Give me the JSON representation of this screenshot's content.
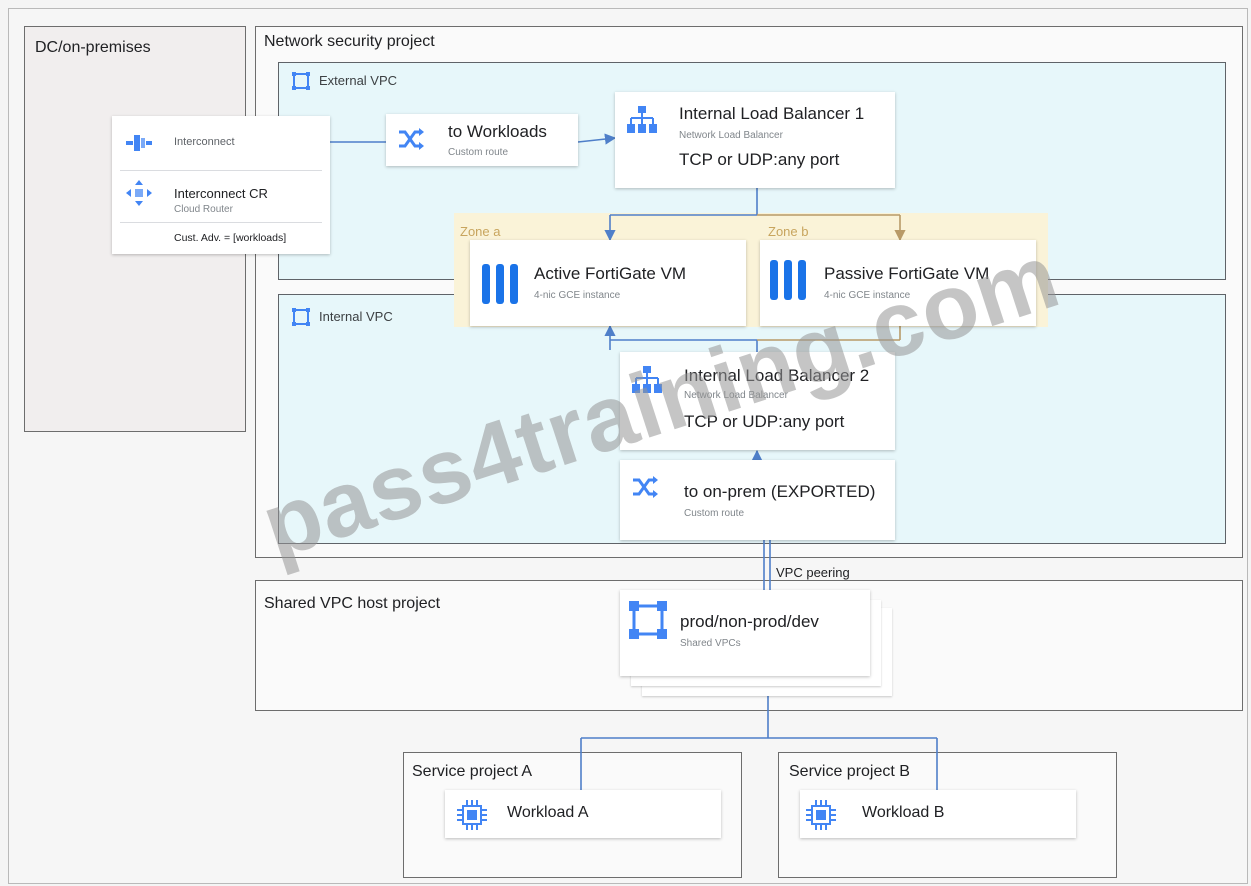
{
  "dc": {
    "title": "DC/on-premises"
  },
  "network_security_project": {
    "title": "Network security project",
    "external_vpc": {
      "label": "External VPC"
    },
    "internal_vpc": {
      "label": "Internal VPC"
    },
    "zone_a": "Zone a",
    "zone_b": "Zone b"
  },
  "interconnect_card": {
    "interconnect_label": "Interconnect",
    "router_title": "Interconnect CR",
    "router_sub": "Cloud Router",
    "advert": "Cust. Adv. = [workloads]"
  },
  "route_to_workloads": {
    "title": "to Workloads",
    "sub": "Custom route"
  },
  "ilb1": {
    "title": "Internal Load Balancer 1",
    "sub": "Network Load Balancer",
    "ports": "TCP or UDP:any port"
  },
  "active_vm": {
    "title": "Active FortiGate VM",
    "sub": "4-nic GCE instance"
  },
  "passive_vm": {
    "title": "Passive FortiGate VM",
    "sub": "4-nic GCE instance"
  },
  "ilb2": {
    "title": "Internal Load Balancer 2",
    "sub": "Network Load Balancer",
    "ports": "TCP or UDP:any port"
  },
  "route_to_onprem": {
    "title": "to on-prem (EXPORTED)",
    "sub": "Custom route"
  },
  "vpc_peering": "VPC peering",
  "shared_vpc_host": {
    "title": "Shared VPC host project",
    "card_title": "prod/non-prod/dev",
    "card_sub": "Shared VPCs"
  },
  "service_a": {
    "title": "Service project A",
    "workload": "Workload A"
  },
  "service_b": {
    "title": "Service project B",
    "workload": "Workload B"
  },
  "watermark": "pass4training.com",
  "colors": {
    "google_blue": "#4285f4",
    "vpc_fill": "#e7f7fa",
    "zone_fill": "#faf3d8",
    "zone_text": "#c8a55e"
  }
}
